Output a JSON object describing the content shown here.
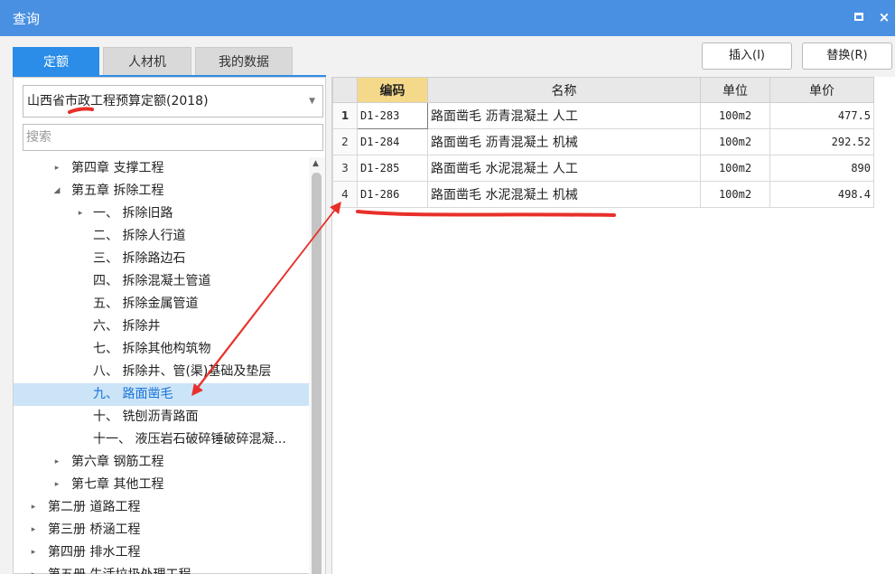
{
  "window": {
    "title": "查询",
    "restore_label": "",
    "close_label": "×"
  },
  "tabs": [
    {
      "label": "定额",
      "active": true
    },
    {
      "label": "人材机",
      "active": false
    },
    {
      "label": "我的数据",
      "active": false
    }
  ],
  "actions": {
    "insert_label": "插入(I)",
    "replace_label": "替换(R)"
  },
  "left": {
    "dictionary_value": "山西省市政工程预算定额(2018)",
    "search_placeholder": "搜索",
    "tree": [
      {
        "label": "第四章 支撑工程",
        "arrow": "▸"
      },
      {
        "label": "第五章 拆除工程",
        "arrow": "◢"
      },
      {
        "label": "一、 拆除旧路",
        "arrow": "▸"
      },
      {
        "label": "二、 拆除人行道",
        "arrow": ""
      },
      {
        "label": "三、 拆除路边石",
        "arrow": ""
      },
      {
        "label": "四、 拆除混凝土管道",
        "arrow": ""
      },
      {
        "label": "五、 拆除金属管道",
        "arrow": ""
      },
      {
        "label": "六、 拆除井",
        "arrow": ""
      },
      {
        "label": "七、 拆除其他构筑物",
        "arrow": ""
      },
      {
        "label": "八、 拆除井、管(渠)基础及垫层",
        "arrow": ""
      },
      {
        "label": "九、 路面凿毛",
        "arrow": "",
        "selected": true
      },
      {
        "label": "十、 铣刨沥青路面",
        "arrow": ""
      },
      {
        "label": "十一、 液压岩石破碎锤破碎混凝...",
        "arrow": ""
      },
      {
        "label": "第六章 钢筋工程",
        "arrow": "▸"
      },
      {
        "label": "第七章 其他工程",
        "arrow": "▸"
      },
      {
        "label": "第二册 道路工程",
        "arrow": "▸"
      },
      {
        "label": "第三册 桥涵工程",
        "arrow": "▸"
      },
      {
        "label": "第四册 排水工程",
        "arrow": "▸"
      },
      {
        "label": "第五册 生活垃圾处理工程",
        "arrow": "▸"
      }
    ]
  },
  "grid": {
    "headers": {
      "code": "编码",
      "name": "名称",
      "unit": "单位",
      "price": "单价"
    },
    "rows": [
      {
        "num": "1",
        "code": "D1-283",
        "name": "路面凿毛 沥青混凝土 人工",
        "unit": "100m2",
        "price": "477.5"
      },
      {
        "num": "2",
        "code": "D1-284",
        "name": "路面凿毛 沥青混凝土 机械",
        "unit": "100m2",
        "price": "292.52"
      },
      {
        "num": "3",
        "code": "D1-285",
        "name": "路面凿毛 水泥混凝土 人工",
        "unit": "100m2",
        "price": "890"
      },
      {
        "num": "4",
        "code": "D1-286",
        "name": "路面凿毛 水泥混凝土 机械",
        "unit": "100m2",
        "price": "498.4"
      }
    ]
  },
  "colors": {
    "titlebar": "#4a90e2",
    "tab_active": "#2b8de8",
    "selected_row": "#cce4f7",
    "code_header": "#f5d98a",
    "annotation": "#e8302a"
  }
}
